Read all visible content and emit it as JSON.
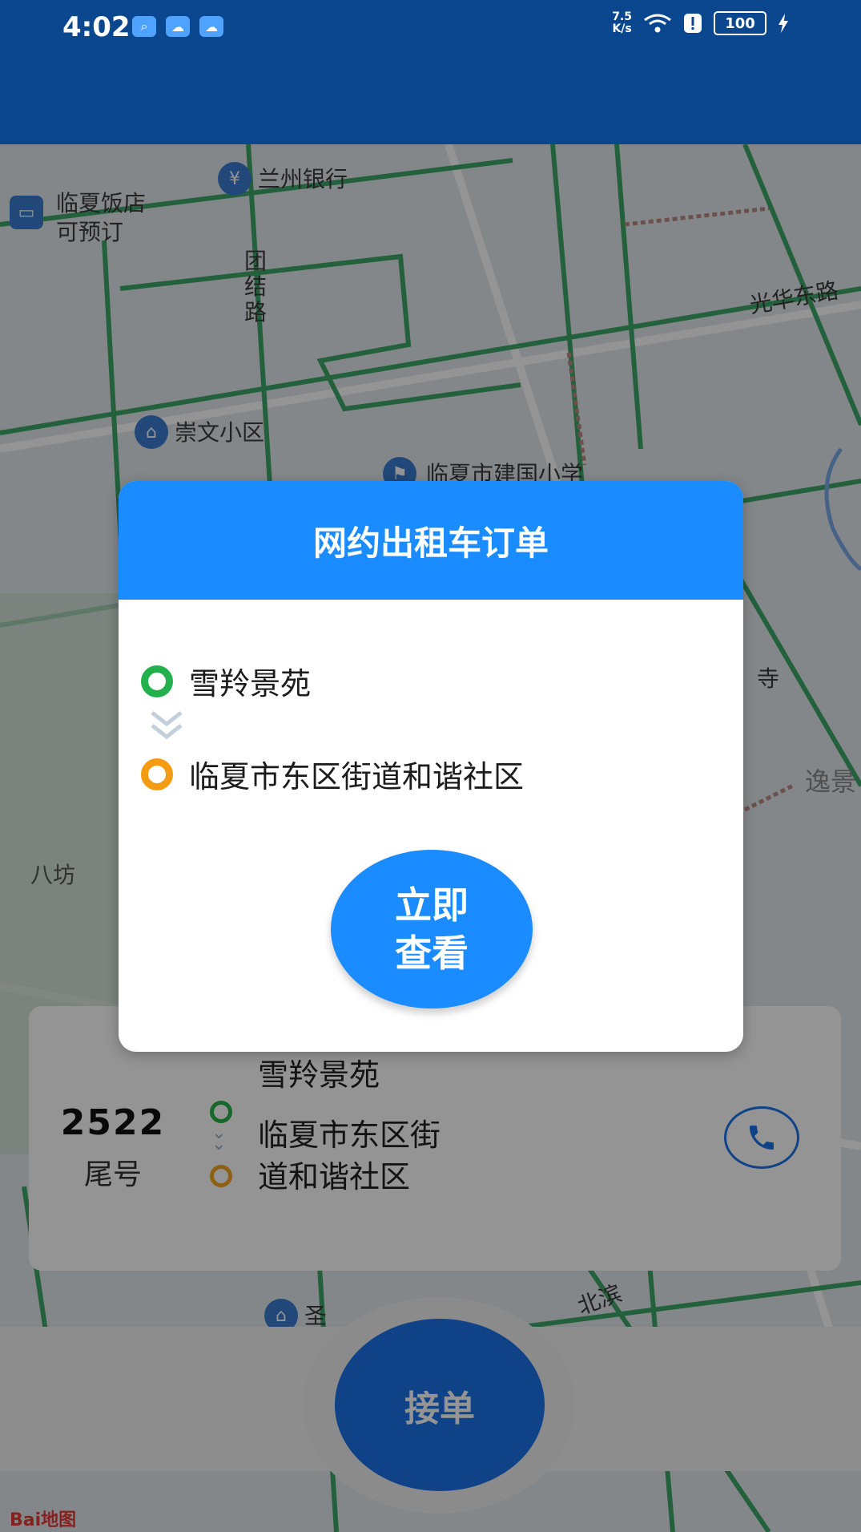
{
  "status_bar": {
    "time": "4:02",
    "net_speed_value": "7.5",
    "net_speed_unit": "K/s",
    "battery": "100"
  },
  "map": {
    "labels": {
      "bank": "兰州银行",
      "hotel": "临夏饭店",
      "hotel_sub": "可预订",
      "road_tuanjie": "团\n结\n路",
      "road_guanghua": "光华东路",
      "community": "崇文小区",
      "school": "临夏市建国小学",
      "temple": "寺",
      "area_yijing": "逸景",
      "bafang": "八坊",
      "road_bottom": "北滨",
      "poi_bottom": "圣"
    },
    "baidu_logo": "Bai地图"
  },
  "modal": {
    "title": "网约出租车订单",
    "start": "雪羚景苑",
    "end": "临夏市东区街道和谐社区",
    "view_button": "立即查看"
  },
  "trip_card": {
    "tail_number": "2522",
    "tail_label": "尾号",
    "start": "雪羚景苑",
    "end": "临夏市东区街道和谐社区"
  },
  "accept_button": "接单",
  "colors": {
    "header_blue": "#0a478f",
    "accent_blue": "#1a8cff",
    "start_green": "#22b14c",
    "end_orange": "#f39c12"
  }
}
